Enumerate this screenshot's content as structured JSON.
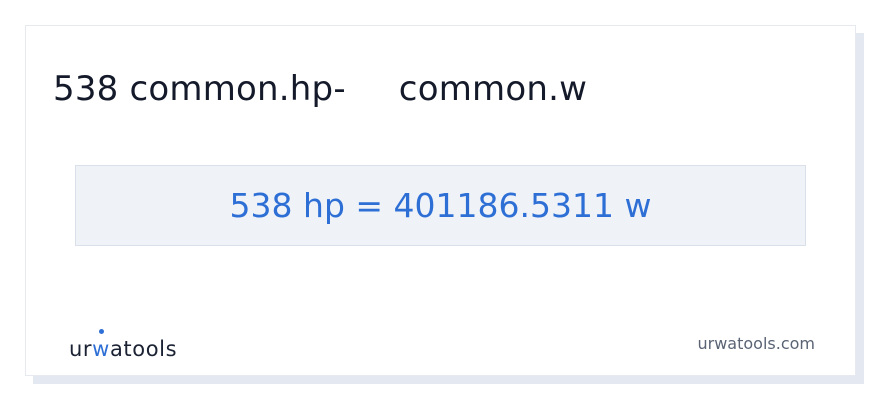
{
  "title": {
    "from": "538 common.hp-",
    "to": "common.w"
  },
  "result": {
    "text": "538 hp = 401186.5311 w"
  },
  "brand": {
    "prefix": "ur",
    "accent": "w",
    "suffix": "atools"
  },
  "footer": {
    "domain": "urwatools.com"
  },
  "colors": {
    "accent": "#2e6fd6",
    "text": "#141a2a",
    "result_bg": "#eff3f8"
  }
}
